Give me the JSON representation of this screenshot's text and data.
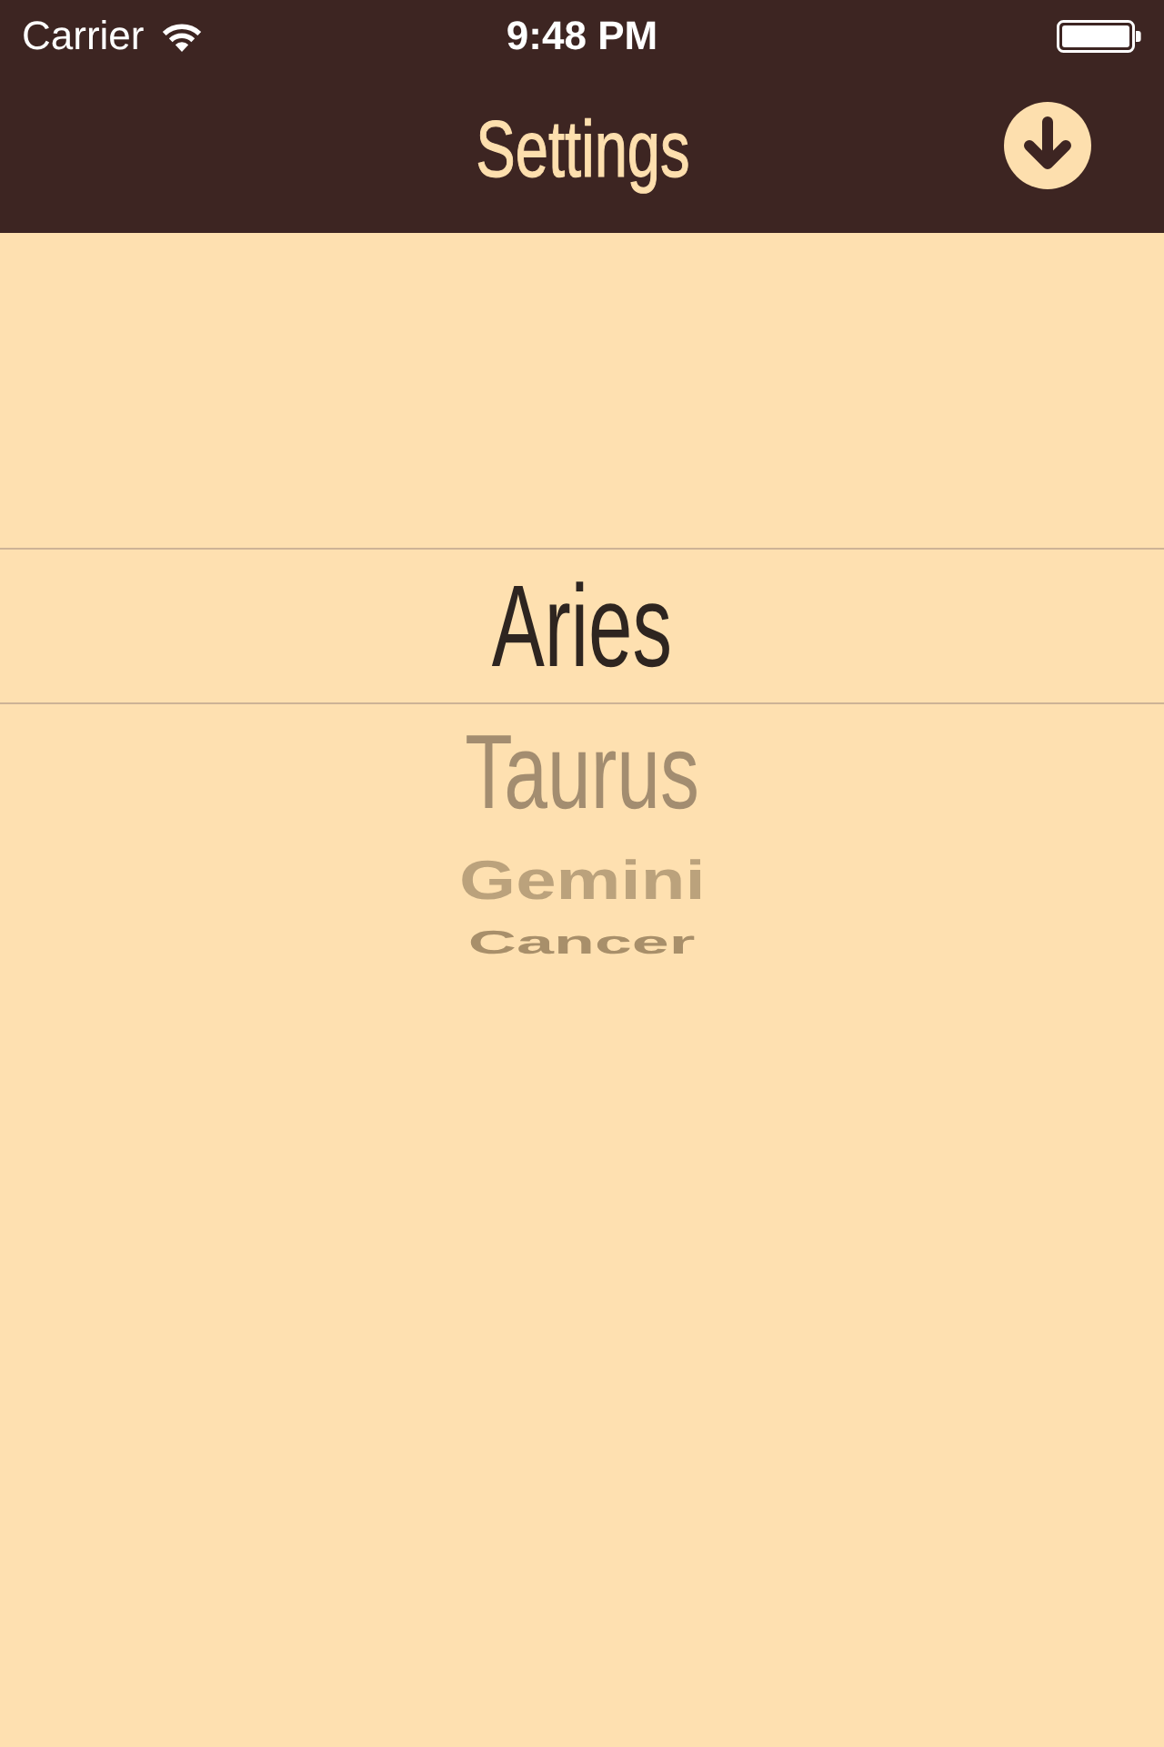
{
  "status_bar": {
    "carrier": "Carrier",
    "time": "9:48 PM"
  },
  "nav_bar": {
    "title": "Settings"
  },
  "picker": {
    "items": [
      {
        "label": "Aries",
        "selected": true
      },
      {
        "label": "Taurus",
        "selected": false
      },
      {
        "label": "Gemini",
        "selected": false
      },
      {
        "label": "Cancer",
        "selected": false
      }
    ]
  }
}
